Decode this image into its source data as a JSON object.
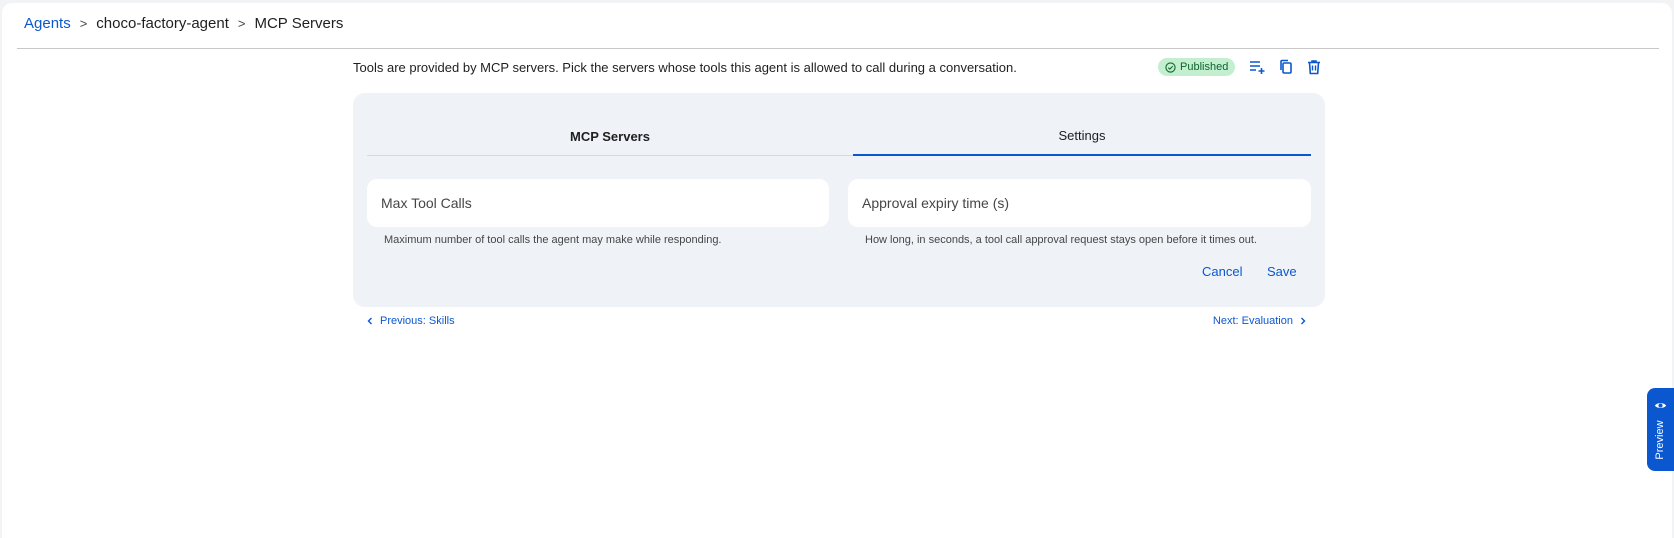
{
  "breadcrumb": {
    "root": "Agents",
    "separator": ">",
    "agent": "choco-factory-agent",
    "current": "MCP Servers"
  },
  "description": "Tools are provided by MCP servers. Pick the servers whose tools this agent is allowed to call during a conversation.",
  "status_badge": {
    "label": "Published",
    "color": "#c4eed0"
  },
  "toolbar": {
    "icons": [
      "add-list-icon",
      "copy-icon",
      "delete-icon"
    ]
  },
  "tabs": [
    {
      "label": "MCP Servers",
      "active": false
    },
    {
      "label": "Settings",
      "active": true
    }
  ],
  "settings": {
    "max_tool_calls": {
      "placeholder": "Max Tool Calls",
      "hint": "Maximum number of tool calls the agent may make while responding."
    },
    "approval_expiry": {
      "placeholder": "Approval expiry time (s)",
      "hint": "How long, in seconds, a tool call approval request stays open before it times out."
    },
    "cancel_label": "Cancel",
    "save_label": "Save"
  },
  "navigation": {
    "previous": "Previous: Skills",
    "next": "Next: Evaluation"
  },
  "preview": {
    "label": "Preview"
  },
  "accent_color": "#0b57d0"
}
